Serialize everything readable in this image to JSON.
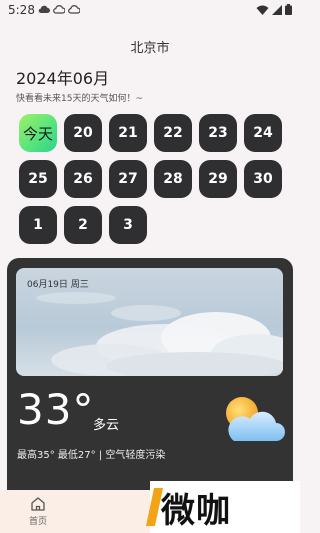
{
  "status_bar": {
    "time": "5:28",
    "notification_icons": [
      "cloud-icon",
      "cloud-outline-icon",
      "cloud-outline-icon"
    ],
    "system_icons": [
      "wifi-icon",
      "signal-icon",
      "battery-icon"
    ]
  },
  "header": {
    "city": "北京市",
    "month_title": "2024年06月",
    "subtitle": "快看看未来15天的天气如何！~"
  },
  "days": [
    "今天",
    "20",
    "21",
    "22",
    "23",
    "24",
    "25",
    "26",
    "27",
    "28",
    "29",
    "30",
    "1",
    "2",
    "3"
  ],
  "weather_card": {
    "date": "06月19日 周三",
    "temperature": "33°",
    "condition": "多云",
    "details": "最高35° 最低27° | 空气轻度污染",
    "icon": "partly-cloudy-icon"
  },
  "bottom_nav": {
    "items": [
      {
        "label": "首页",
        "icon": "home-icon"
      }
    ]
  },
  "watermark": {
    "text": "微咖"
  },
  "colors": {
    "background": "#f7f2f4",
    "day_cell": "#2f2f31",
    "today_gradient_start": "#9ef06a",
    "today_gradient_end": "#2ed18d",
    "card": "#333334",
    "watermark_accent": "#f3a316"
  }
}
